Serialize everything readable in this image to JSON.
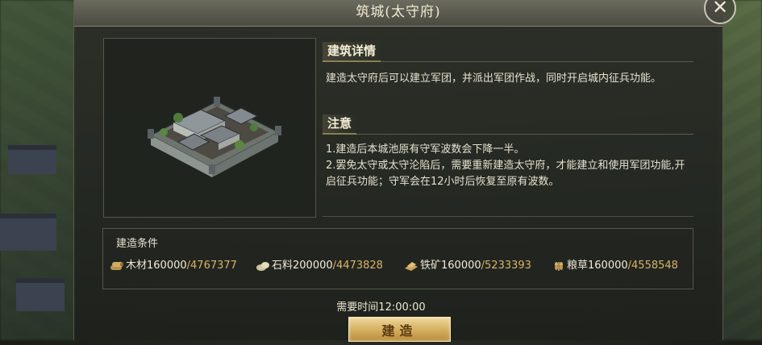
{
  "window": {
    "title": "筑城(太守府)"
  },
  "details": {
    "heading": "建筑详情",
    "text": "建造太守府后可以建立军团，并派出军团作战，同时开启城内征兵功能。"
  },
  "notice": {
    "heading": "注意",
    "line1": "1.建造后本城池原有守军波数会下降一半。",
    "line2": "2.罢免太守或太守沦陷后，需要重新建造太守府，才能建立和使用军团功能,开启征兵功能；守军会在12小时后恢复至原有波数。"
  },
  "conditions": {
    "heading": "建造条件",
    "resources": [
      {
        "icon": "wood-icon",
        "name": "木材",
        "required": "160000",
        "owned": "/4767377"
      },
      {
        "icon": "stone-icon",
        "name": "石料",
        "required": "200000",
        "owned": "/4473828"
      },
      {
        "icon": "iron-ore-icon",
        "name": "铁矿",
        "required": "160000",
        "owned": "/5233393"
      },
      {
        "icon": "grain-icon",
        "name": "粮草",
        "required": "160000",
        "owned": "/4558548"
      }
    ]
  },
  "time": {
    "label": "需要时间12:00:00"
  },
  "actions": {
    "build_label": "建造"
  },
  "colors": {
    "accent_gold": "#d9b36a",
    "button_gold": "#d3ae5d"
  }
}
